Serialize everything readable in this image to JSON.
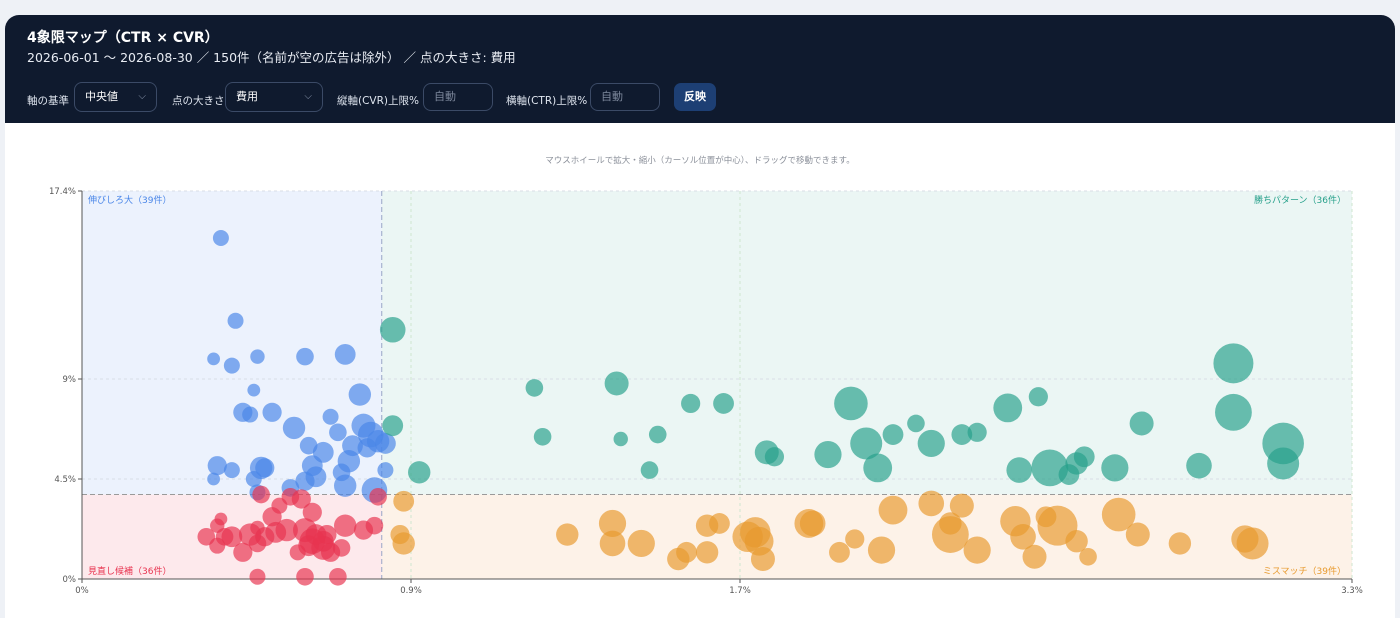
{
  "header": {
    "title": "4象限マップ（CTR × CVR）",
    "subtitle": "2026-06-01 〜 2026-08-30 ／ 150件（名前が空の広告は除外） ／ 点の大きさ: 費用"
  },
  "controls": {
    "axis_basis_label": "軸の基準",
    "axis_basis_value": "中央値",
    "point_size_label": "点の大きさ",
    "point_size_value": "費用",
    "cvr_max_label": "縦軸(CVR)上限%",
    "cvr_max_placeholder": "自動",
    "ctr_max_label": "横軸(CTR)上限%",
    "ctr_max_placeholder": "自動",
    "apply_label": "反映"
  },
  "hint": "マウスホイールで拡大・縮小（カーソル位置が中心）、ドラッグで移動できます。",
  "chart_data": {
    "type": "scatter",
    "xlabel": "",
    "ylabel": "",
    "xlim": [
      0,
      3.3
    ],
    "ylim": [
      0,
      17.4
    ],
    "x_ticks": [
      "0%",
      "0.9%",
      "1.7%",
      "3.3%"
    ],
    "x_tick_values": [
      0,
      0.9,
      1.7,
      3.3
    ],
    "y_ticks": [
      "0%",
      "4.5%",
      "9%",
      "17.4%"
    ],
    "y_tick_values": [
      0,
      4.5,
      9,
      17.4
    ],
    "median_ctr": 0.82,
    "median_cvr": 3.8,
    "quadrants": {
      "top_left": {
        "label": "伸びしろ大（39件）",
        "color": "#4a86e8"
      },
      "top_right": {
        "label": "勝ちパターン（36件）",
        "color": "#26a08a"
      },
      "bottom_left": {
        "label": "見直し候補（36件）",
        "color": "#e8334f"
      },
      "bottom_right": {
        "label": "ミスマッチ（39件）",
        "color": "#e89a2e"
      }
    },
    "series": [
      {
        "quadrant": "top_left",
        "points": [
          [
            0.38,
            15.3,
            1
          ],
          [
            0.42,
            11.6,
            1
          ],
          [
            0.36,
            9.9,
            0.8
          ],
          [
            0.41,
            9.6,
            1
          ],
          [
            0.48,
            10.0,
            0.9
          ],
          [
            0.61,
            10.0,
            1.1
          ],
          [
            0.72,
            10.1,
            1.3
          ],
          [
            0.47,
            8.5,
            0.8
          ],
          [
            0.44,
            7.5,
            1.2
          ],
          [
            0.46,
            7.4,
            1
          ],
          [
            0.52,
            7.5,
            1.2
          ],
          [
            0.68,
            7.3,
            1
          ],
          [
            0.76,
            8.3,
            1.4
          ],
          [
            0.58,
            6.8,
            1.4
          ],
          [
            0.7,
            6.6,
            1.1
          ],
          [
            0.77,
            6.9,
            1.5
          ],
          [
            0.79,
            6.5,
            1.6
          ],
          [
            0.81,
            6.2,
            1.4
          ],
          [
            0.62,
            6.0,
            1.1
          ],
          [
            0.66,
            5.7,
            1.3
          ],
          [
            0.74,
            6.0,
            1.3
          ],
          [
            0.78,
            5.9,
            1.2
          ],
          [
            0.37,
            5.1,
            1.2
          ],
          [
            0.41,
            4.9,
            1
          ],
          [
            0.49,
            5.0,
            1.4
          ],
          [
            0.5,
            5.0,
            1.2
          ],
          [
            0.63,
            5.1,
            1.3
          ],
          [
            0.73,
            5.3,
            1.4
          ],
          [
            0.36,
            4.5,
            0.8
          ],
          [
            0.47,
            4.5,
            1
          ],
          [
            0.64,
            4.6,
            1.3
          ],
          [
            0.71,
            4.8,
            1.1
          ],
          [
            0.83,
            4.9,
            1
          ],
          [
            0.8,
            4.0,
            1.6
          ],
          [
            0.48,
            3.9,
            1
          ],
          [
            0.57,
            4.1,
            1.1
          ],
          [
            0.72,
            4.2,
            1.4
          ],
          [
            0.61,
            4.4,
            1.2
          ],
          [
            0.83,
            6.1,
            1.3
          ]
        ]
      },
      {
        "quadrant": "bottom_left",
        "points": [
          [
            0.38,
            2.7,
            0.8
          ],
          [
            0.37,
            2.4,
            0.9
          ],
          [
            0.34,
            1.9,
            1.1
          ],
          [
            0.37,
            1.5,
            1
          ],
          [
            0.41,
            1.9,
            1.3
          ],
          [
            0.44,
            1.2,
            1.2
          ],
          [
            0.48,
            1.6,
            1.1
          ],
          [
            0.5,
            1.9,
            1.2
          ],
          [
            0.48,
            2.3,
            0.9
          ],
          [
            0.52,
            2.8,
            1.2
          ],
          [
            0.54,
            3.3,
            1
          ],
          [
            0.57,
            3.7,
            1.1
          ],
          [
            0.56,
            2.2,
            1.4
          ],
          [
            0.61,
            2.2,
            1.5
          ],
          [
            0.63,
            1.7,
            1.6
          ],
          [
            0.62,
            1.5,
            1.3
          ],
          [
            0.66,
            1.7,
            1.3
          ],
          [
            0.67,
            2.0,
            1.2
          ],
          [
            0.68,
            1.2,
            1.2
          ],
          [
            0.71,
            1.4,
            1.1
          ],
          [
            0.72,
            2.4,
            1.4
          ],
          [
            0.77,
            2.2,
            1.2
          ],
          [
            0.8,
            2.4,
            1.1
          ],
          [
            0.81,
            3.7,
            1.1
          ],
          [
            0.63,
            3.0,
            1.2
          ],
          [
            0.6,
            3.6,
            1.2
          ],
          [
            0.49,
            3.8,
            1.1
          ],
          [
            0.64,
            2.0,
            1.3
          ],
          [
            0.59,
            1.2,
            1.0
          ],
          [
            0.61,
            0.1,
            1.1
          ],
          [
            0.7,
            0.1,
            1.1
          ],
          [
            0.48,
            0.1,
            1
          ],
          [
            0.39,
            1.9,
            1.1
          ],
          [
            0.46,
            2.0,
            1.4
          ],
          [
            0.53,
            2.1,
            1.3
          ],
          [
            0.66,
            1.4,
            1.5
          ]
        ]
      },
      {
        "quadrant": "top_right",
        "points": [
          [
            0.85,
            11.2,
            1.6
          ],
          [
            0.85,
            6.9,
            1.3
          ],
          [
            0.92,
            4.8,
            1.4
          ],
          [
            1.2,
            8.6,
            1.1
          ],
          [
            1.22,
            6.4,
            1.1
          ],
          [
            1.4,
            8.8,
            1.5
          ],
          [
            1.41,
            6.3,
            0.9
          ],
          [
            1.48,
            4.9,
            1.1
          ],
          [
            1.5,
            6.5,
            1.1
          ],
          [
            1.58,
            7.9,
            1.2
          ],
          [
            1.66,
            7.9,
            1.3
          ],
          [
            1.77,
            5.7,
            1.5
          ],
          [
            1.79,
            5.5,
            1.2
          ],
          [
            1.93,
            5.6,
            1.7
          ],
          [
            1.99,
            7.9,
            2.1
          ],
          [
            2.03,
            6.1,
            2.0
          ],
          [
            2.06,
            5.0,
            1.8
          ],
          [
            2.1,
            6.5,
            1.3
          ],
          [
            2.16,
            7.0,
            1.1
          ],
          [
            2.2,
            6.1,
            1.7
          ],
          [
            2.28,
            6.5,
            1.3
          ],
          [
            2.32,
            6.6,
            1.2
          ],
          [
            2.4,
            7.7,
            1.8
          ],
          [
            2.43,
            4.9,
            1.6
          ],
          [
            2.48,
            8.2,
            1.2
          ],
          [
            2.51,
            5.0,
            2.3
          ],
          [
            2.56,
            4.7,
            1.3
          ],
          [
            2.6,
            5.5,
            1.3
          ],
          [
            2.58,
            5.2,
            1.4
          ],
          [
            2.68,
            5.0,
            1.7
          ],
          [
            2.75,
            7.0,
            1.5
          ],
          [
            2.9,
            5.1,
            1.6
          ],
          [
            2.99,
            9.7,
            2.5
          ],
          [
            2.99,
            7.5,
            2.3
          ],
          [
            3.12,
            6.1,
            2.6
          ],
          [
            3.12,
            5.2,
            2.0
          ]
        ]
      },
      {
        "quadrant": "bottom_right",
        "points": [
          [
            0.88,
            3.5,
            1.3
          ],
          [
            0.87,
            2.0,
            1.2
          ],
          [
            0.88,
            1.6,
            1.4
          ],
          [
            1.28,
            2.0,
            1.4
          ],
          [
            1.39,
            2.5,
            1.7
          ],
          [
            1.39,
            1.6,
            1.6
          ],
          [
            1.46,
            1.6,
            1.7
          ],
          [
            1.55,
            0.9,
            1.4
          ],
          [
            1.57,
            1.2,
            1.3
          ],
          [
            1.62,
            1.2,
            1.4
          ],
          [
            1.62,
            2.4,
            1.4
          ],
          [
            1.65,
            2.5,
            1.3
          ],
          [
            1.72,
            1.9,
            1.9
          ],
          [
            1.75,
            1.7,
            1.8
          ],
          [
            1.74,
            2.1,
            1.9
          ],
          [
            1.76,
            0.9,
            1.5
          ],
          [
            1.88,
            2.5,
            1.8
          ],
          [
            1.89,
            2.5,
            1.6
          ],
          [
            1.96,
            1.2,
            1.3
          ],
          [
            2.0,
            1.8,
            1.2
          ],
          [
            2.07,
            1.3,
            1.7
          ],
          [
            2.1,
            3.1,
            1.8
          ],
          [
            2.2,
            3.4,
            1.6
          ],
          [
            2.25,
            2.5,
            1.4
          ],
          [
            2.25,
            2.0,
            2.3
          ],
          [
            2.28,
            3.3,
            1.5
          ],
          [
            2.32,
            1.3,
            1.7
          ],
          [
            2.42,
            2.6,
            1.9
          ],
          [
            2.44,
            1.9,
            1.6
          ],
          [
            2.47,
            1.0,
            1.5
          ],
          [
            2.5,
            2.8,
            1.3
          ],
          [
            2.53,
            2.4,
            2.5
          ],
          [
            2.58,
            1.7,
            1.4
          ],
          [
            2.61,
            1.0,
            1.1
          ],
          [
            2.69,
            2.9,
            2.1
          ],
          [
            2.74,
            2.0,
            1.5
          ],
          [
            2.85,
            1.6,
            1.4
          ],
          [
            3.02,
            1.8,
            1.7
          ],
          [
            3.04,
            1.6,
            2.0
          ]
        ]
      }
    ]
  }
}
